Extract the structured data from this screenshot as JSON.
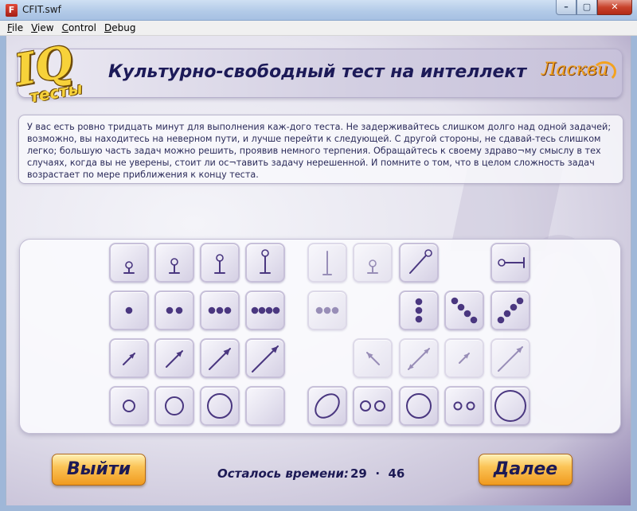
{
  "window": {
    "title": "CFIT.swf",
    "icon_glyph": "F",
    "minimize_glyph": "–",
    "maximize_glyph": "▢",
    "close_glyph": "✕"
  },
  "menu": [
    {
      "label": "File",
      "underline": "F",
      "rest": "ile"
    },
    {
      "label": "View",
      "underline": "V",
      "rest": "iew"
    },
    {
      "label": "Control",
      "underline": "C",
      "rest": "ontrol"
    },
    {
      "label": "Debug",
      "underline": "D",
      "rest": "ebug"
    }
  ],
  "header": {
    "logo_main": "IQ",
    "logo_sub": "тесты",
    "title": "Культурно-свободный тест на интеллект",
    "brand": "Ласкви"
  },
  "instructions": "У вас есть ровно тридцать минут для выполнения каж-дого теста. Не задерживайтесь слишком долго над одной задачей; возможно, вы находитесь на неверном пути, и лучше перейти к следующей. С другой стороны, не сдавай-тесь слишком легко; большую часть задач можно решить, проявив немного терпения. Обращайтесь к своему здраво¬му смыслу в тех случаях, когда вы не уверены, стоит ли ос¬тавить задачу нерешенной. И помните о том, что в целом сложность задач возрастает по мере приближения к концу теста.",
  "footer": {
    "exit_label": "Выйти",
    "next_label": "Далее",
    "timer_label": "Осталось времени:",
    "timer_minutes": "29",
    "timer_seconds": "46"
  },
  "colors": {
    "figure": "#4a3780",
    "accent_orange": "#f09a1f",
    "title_navy": "#1c1a58"
  },
  "puzzle_rows": [
    {
      "name": "stick-series",
      "sequence": [
        "stick-short",
        "stick-medium",
        "stick-tall",
        "stick-tallest"
      ],
      "answers": [
        "stick-line",
        "stick-small-faded",
        "stick-diagonal",
        "blank",
        "stick-horizontal"
      ]
    },
    {
      "name": "dot-series",
      "sequence": [
        "dots-1",
        "dots-2",
        "dots-3",
        "dots-4"
      ],
      "answers": [
        "dots-3-faded",
        "blank",
        "dots-3-vertical",
        "dots-4-diagonal-down",
        "dots-4-diagonal-up"
      ]
    },
    {
      "name": "arrow-series",
      "sequence": [
        "arrow-small",
        "arrow-medium",
        "arrow-large",
        "arrow-largest"
      ],
      "answers": [
        "blank",
        "arrow-up-left",
        "arrow-double",
        "arrow-small-up",
        "arrow-long"
      ]
    },
    {
      "name": "circle-series",
      "sequence": [
        "circle-small",
        "circle-medium",
        "circle-large",
        "empty"
      ],
      "answers": [
        "ellipse-tilted",
        "circles-pair",
        "circle-large",
        "circles-pair-small",
        "circle-largest"
      ]
    }
  ]
}
